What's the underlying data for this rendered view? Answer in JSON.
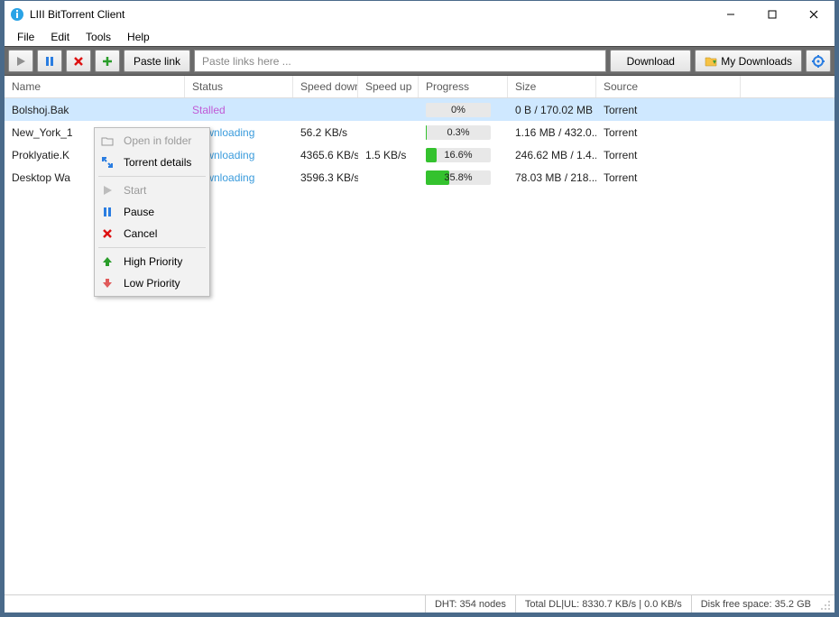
{
  "window": {
    "title": "LIII BitTorrent Client"
  },
  "menu": {
    "file": "File",
    "edit": "Edit",
    "tools": "Tools",
    "help": "Help"
  },
  "toolbar": {
    "paste_link": "Paste link",
    "links_placeholder": "Paste links here ...",
    "download": "Download",
    "my_downloads": "My Downloads"
  },
  "columns": {
    "name": "Name",
    "status": "Status",
    "speed_down": "Speed down",
    "speed_up": "Speed up",
    "progress": "Progress",
    "size": "Size",
    "source": "Source"
  },
  "rows": [
    {
      "name": "Bolshoj.Bak",
      "status": "Stalled",
      "status_kind": "stalled",
      "speed_down": "",
      "speed_up": "",
      "progress_pct": 0,
      "progress_text": "0%",
      "size": "0 B / 170.02 MB",
      "source": "Torrent",
      "selected": true
    },
    {
      "name": "New_York_1",
      "status": "Downloading",
      "status_kind": "downloading",
      "speed_down": "56.2 KB/s",
      "speed_up": "",
      "progress_pct": 0.3,
      "progress_text": "0.3%",
      "size": "1.16 MB / 432.0...",
      "source": "Torrent",
      "selected": false
    },
    {
      "name": "Proklyatie.K",
      "status": "Downloading",
      "status_kind": "downloading",
      "speed_down": "4365.6 KB/s",
      "speed_up": "1.5 KB/s",
      "progress_pct": 16.6,
      "progress_text": "16.6%",
      "size": "246.62 MB / 1.4...",
      "source": "Torrent",
      "selected": false
    },
    {
      "name": "Desktop Wa",
      "status": "Downloading",
      "status_kind": "downloading",
      "speed_down": "3596.3 KB/s",
      "speed_up": "",
      "progress_pct": 35.8,
      "progress_text": "35.8%",
      "size": "78.03 MB / 218...",
      "source": "Torrent",
      "selected": false
    }
  ],
  "context_menu": {
    "open_in_folder": "Open in folder",
    "torrent_details": "Torrent details",
    "start": "Start",
    "pause": "Pause",
    "cancel": "Cancel",
    "high_priority": "High Priority",
    "low_priority": "Low Priority"
  },
  "statusbar": {
    "dht": "DHT: 354 nodes",
    "totals": "Total DL|UL: 8330.7 KB/s | 0.0 KB/s",
    "disk": "Disk free space: 35.2 GB"
  }
}
